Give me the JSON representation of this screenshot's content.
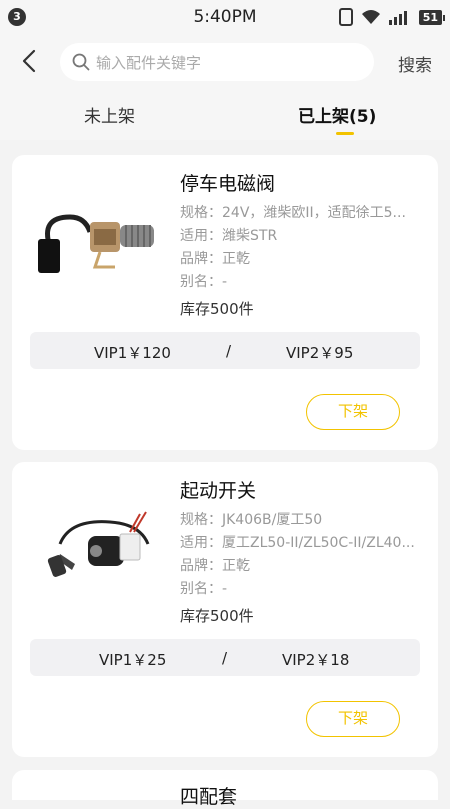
{
  "status_bar": {
    "notification_count": "3",
    "time": "5:40PM",
    "battery": "51"
  },
  "header": {
    "search_placeholder": "输入配件关键字",
    "search_action": "搜索"
  },
  "tabs": [
    {
      "label": "未上架",
      "active": false
    },
    {
      "label": "已上架(5)",
      "active": true
    }
  ],
  "colors": {
    "accent": "#f2c300",
    "background": "#f3f3f3",
    "price_row_bg": "#f1f1f3"
  },
  "products": [
    {
      "title": "停车电磁阀",
      "spec": "规格：24V，潍柴欧II，适配徐工5...",
      "fit": "适用：潍柴STR",
      "brand": "品牌：正乾",
      "alias": "别名：-",
      "stock": "库存500件",
      "vip1": "VIP1￥120",
      "separator": "/",
      "vip2": "VIP2￥95",
      "action": "下架",
      "image_icon": "solenoid-valve-image"
    },
    {
      "title": "起动开关",
      "spec": "规格：JK406B/厦工50",
      "fit": "适用：厦工ZL50-II/ZL50C-II/ZL40...",
      "brand": "品牌：正乾",
      "alias": "别名：-",
      "stock": "库存500件",
      "vip1": "VIP1￥25",
      "separator": "/",
      "vip2": "VIP2￥18",
      "action": "下架",
      "image_icon": "ignition-switch-image"
    },
    {
      "title": "四配套"
    }
  ]
}
